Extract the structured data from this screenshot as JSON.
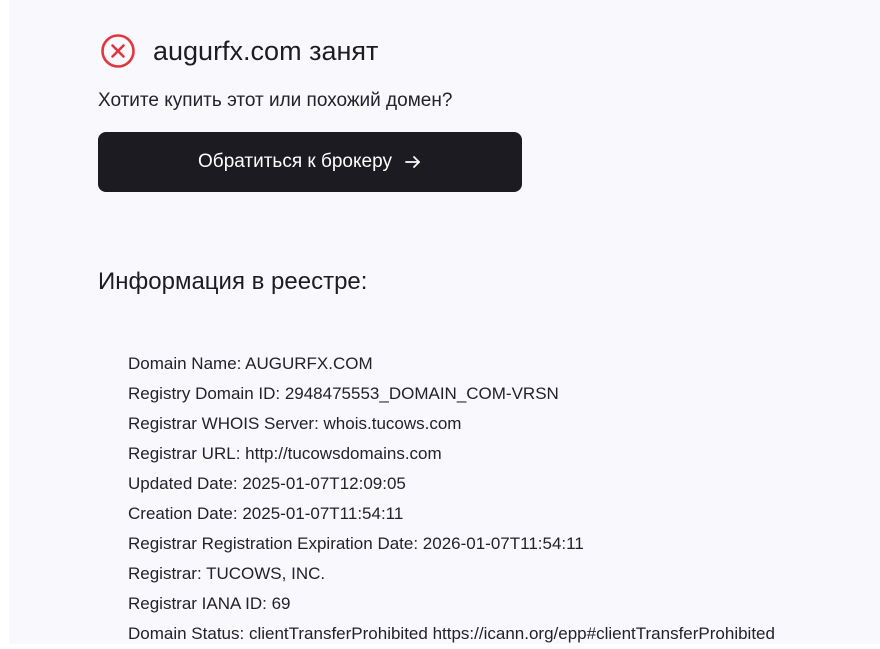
{
  "header": {
    "status_icon": "close-circle-icon",
    "status_color": "#e0373f",
    "domain_status_text": "augurfx.com занят"
  },
  "offer": {
    "question": "Хотите купить этот или похожий домен?",
    "button_label": "Обратиться к брокеру",
    "button_icon": "arrow-right-icon",
    "button_color": "#1b1b21"
  },
  "registry": {
    "heading": "Информация в реестре:",
    "lines": [
      "Domain Name: AUGURFX.COM",
      "Registry Domain ID: 2948475553_DOMAIN_COM-VRSN",
      "Registrar WHOIS Server: whois.tucows.com",
      "Registrar URL: http://tucowsdomains.com",
      "Updated Date: 2025-01-07T12:09:05",
      "Creation Date: 2025-01-07T11:54:11",
      "Registrar Registration Expiration Date: 2026-01-07T11:54:11",
      "Registrar: TUCOWS, INC.",
      "Registrar IANA ID: 69",
      "Domain Status: clientTransferProhibited https://icann.org/epp#clientTransferProhibited"
    ]
  },
  "colors": {
    "background": "#f9f8fd",
    "text": "#1f1f24"
  }
}
